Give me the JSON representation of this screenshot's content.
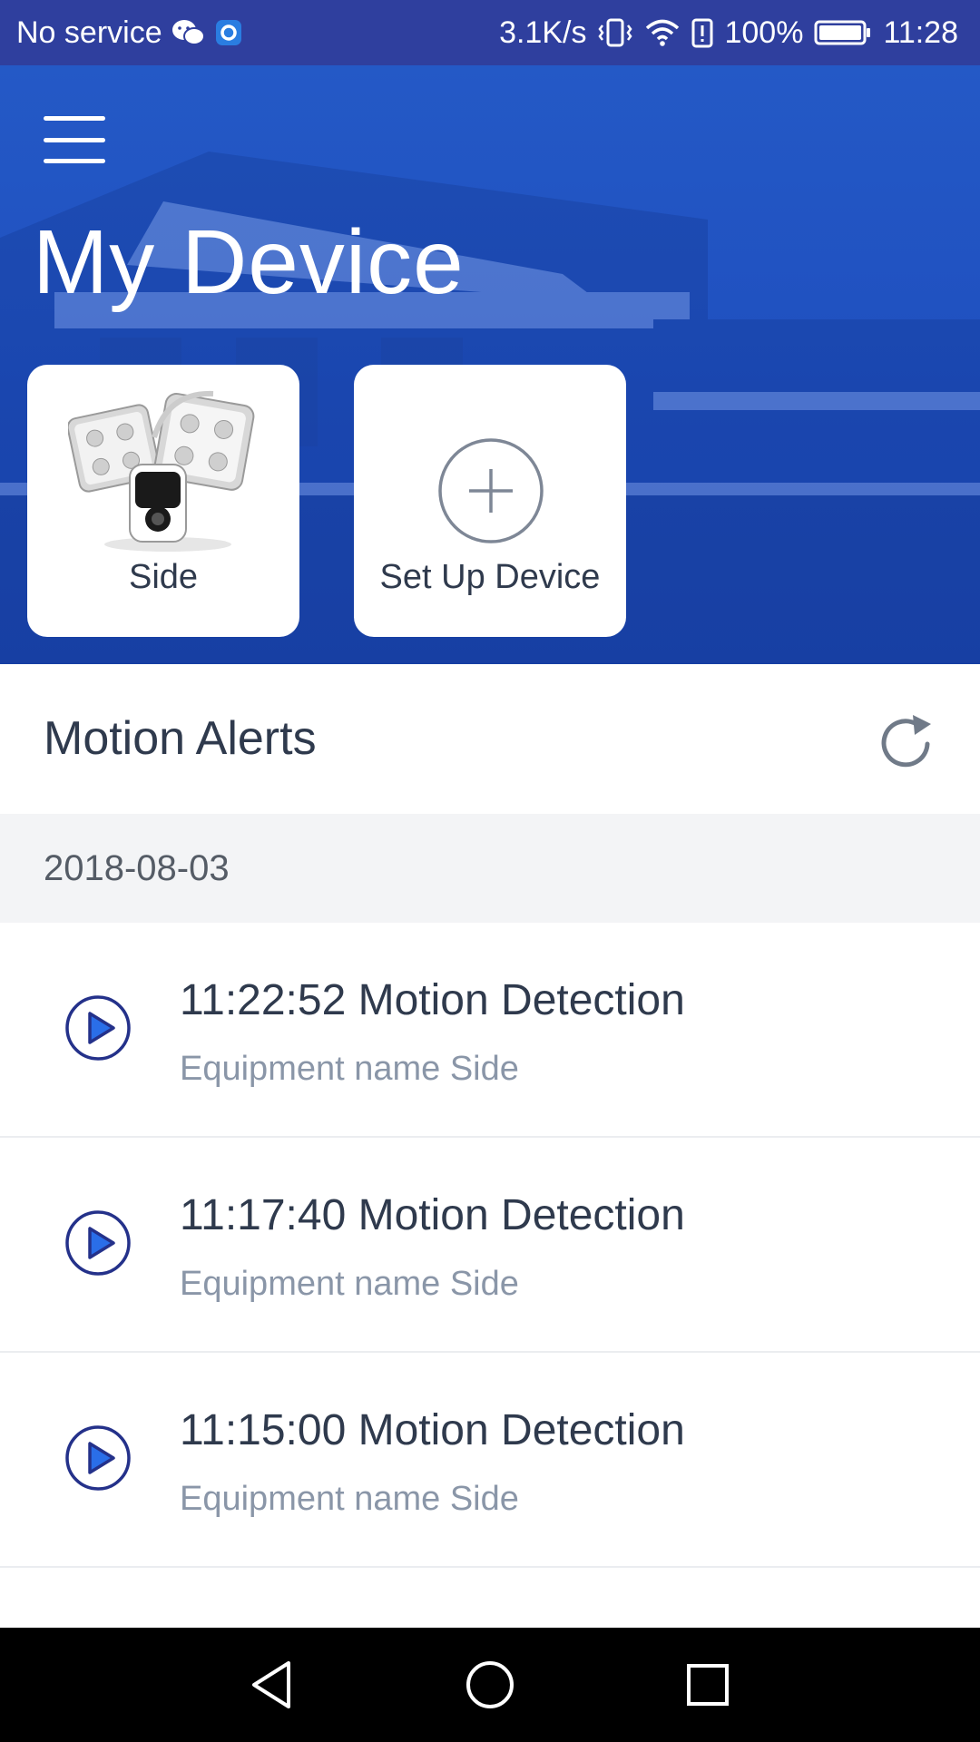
{
  "status_bar": {
    "carrier": "No service",
    "speed": "3.1K/s",
    "battery": "100%",
    "time": "11:28",
    "icons": [
      "wechat-icon",
      "ring-app-icon",
      "vibrate-icon",
      "wifi-icon",
      "battery-alert-icon",
      "battery-icon"
    ]
  },
  "header": {
    "title": "My Device",
    "menu_icon": "hamburger-menu-icon"
  },
  "devices": [
    {
      "label": "Side",
      "icon": "floodlight-camera-icon"
    },
    {
      "label": "Set Up Device",
      "icon": "plus-circle-icon"
    }
  ],
  "alerts": {
    "title": "Motion Alerts",
    "refresh_icon": "refresh-icon",
    "date": "2018-08-03",
    "items": [
      {
        "title": "11:22:52 Motion Detection",
        "subtitle": "Equipment name Side"
      },
      {
        "title": "11:17:40 Motion Detection",
        "subtitle": "Equipment name Side"
      },
      {
        "title": "11:15:00 Motion Detection",
        "subtitle": "Equipment name Side"
      }
    ]
  },
  "nav": {
    "icons": [
      "back-icon",
      "home-icon",
      "recents-icon"
    ]
  },
  "colors": {
    "status_bar": "#2f3f9e",
    "header_blue": "#2459c6",
    "accent_navy": "#24318a",
    "text_dark": "#2f3a4d",
    "text_muted": "#8a96a8"
  }
}
